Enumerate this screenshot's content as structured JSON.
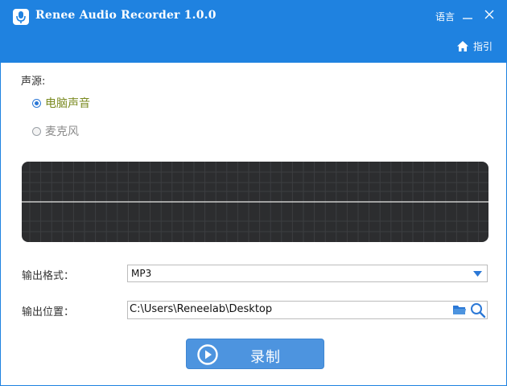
{
  "window": {
    "title": "Renee Audio Recorder 1.0.0",
    "language_label": "语言",
    "help_label": "指引"
  },
  "source": {
    "label": "声源:",
    "options": [
      {
        "label": "电脑声音",
        "selected": true
      },
      {
        "label": "麦克风",
        "selected": false
      }
    ]
  },
  "output_format": {
    "label": "输出格式：",
    "value": "MP3"
  },
  "output_location": {
    "label": "输出位置：",
    "value": "C:\\Users\\Reneelab\\Desktop"
  },
  "record_button": {
    "label": "录制"
  },
  "colors": {
    "titlebar": "#1f82e0",
    "button": "#4d94df",
    "panel": "#2c2d2f",
    "selected_option": "#7a8a20"
  }
}
